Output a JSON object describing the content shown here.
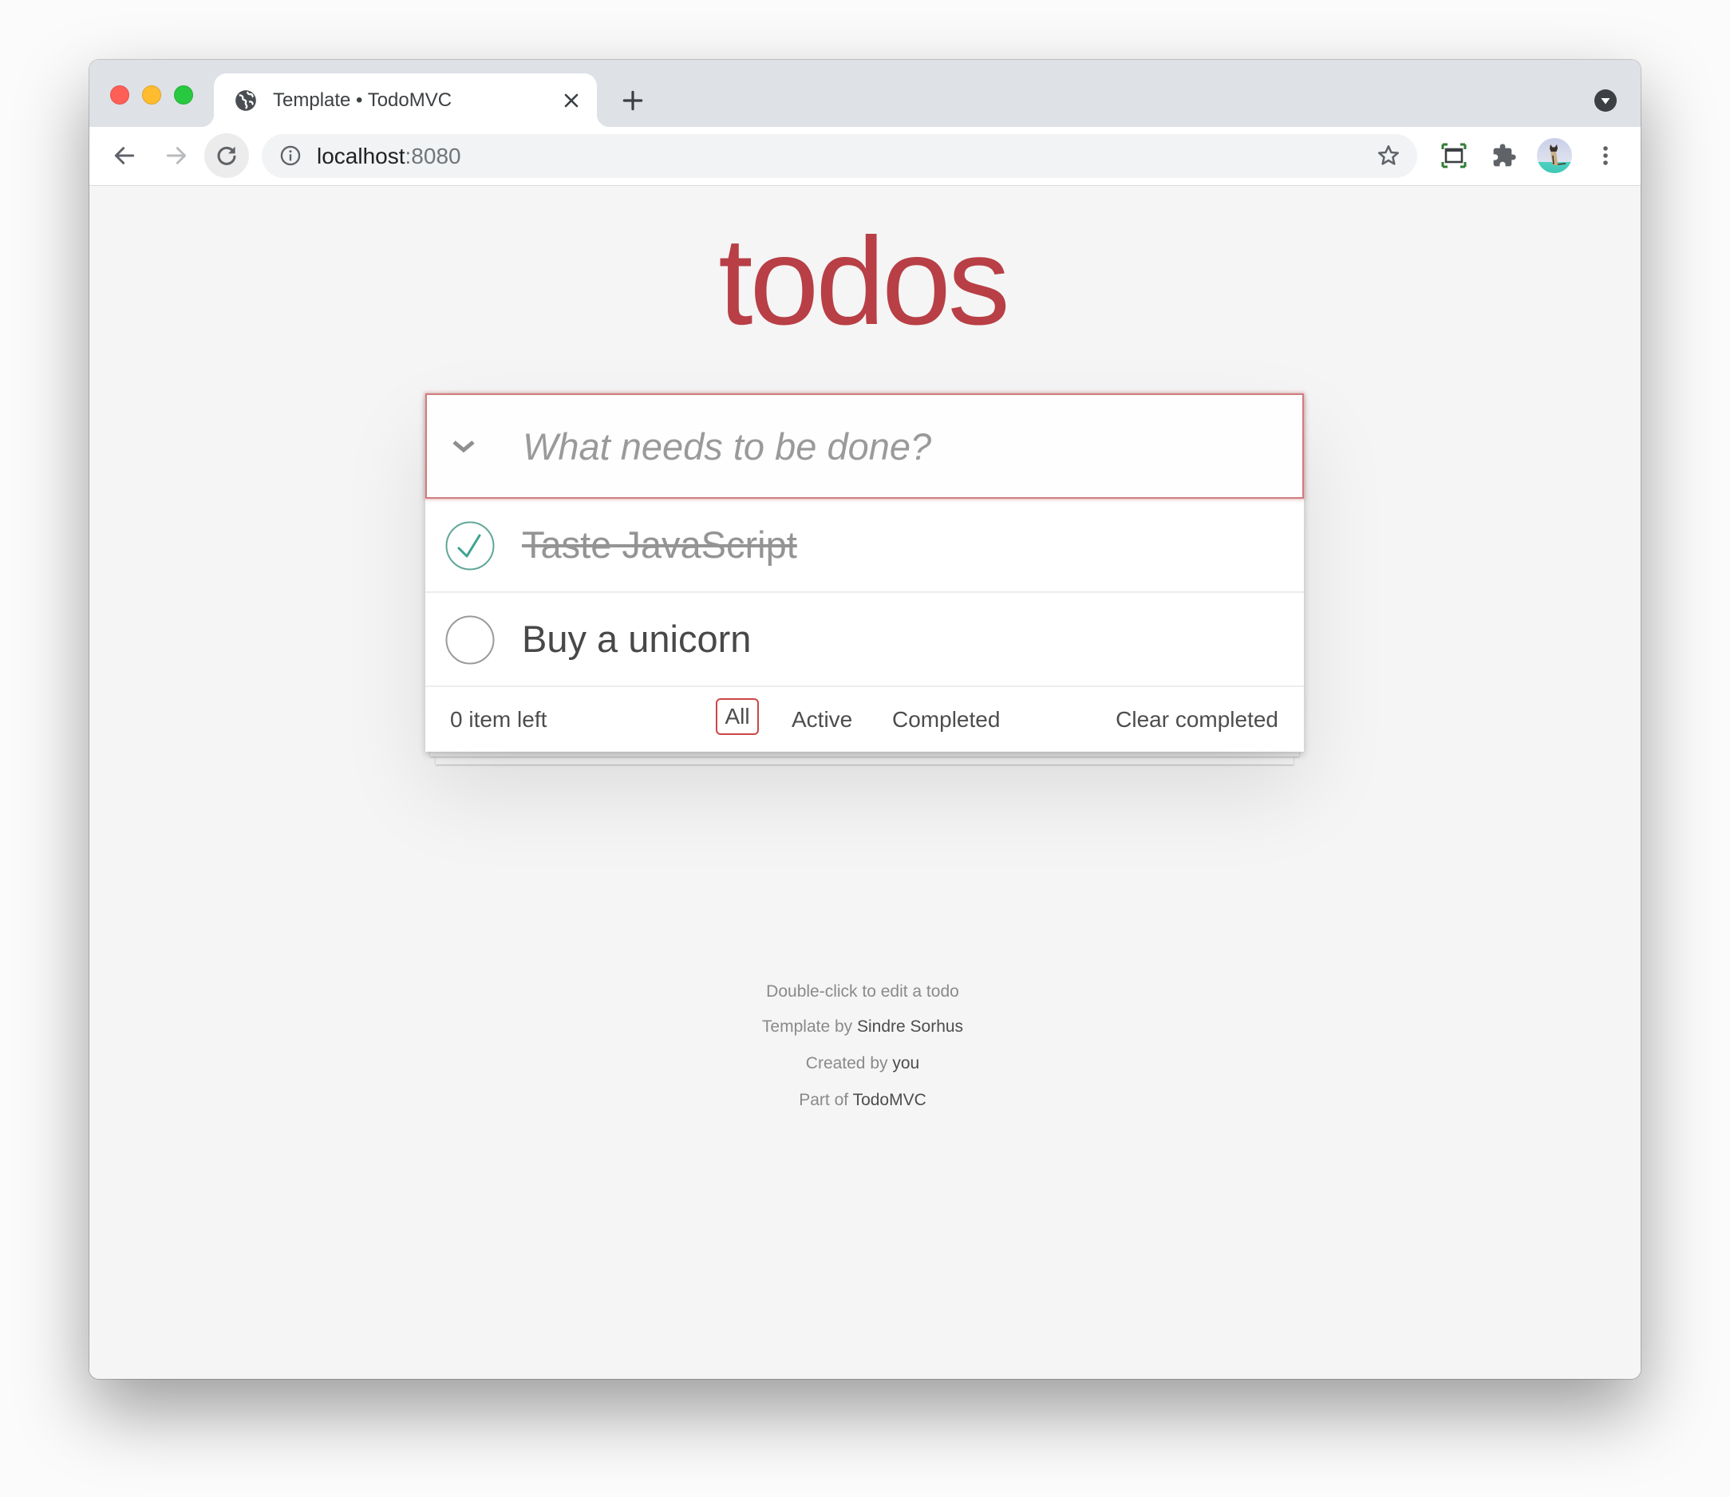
{
  "browser": {
    "tab": {
      "title": "Template • TodoMVC",
      "favicon": "globe-icon",
      "close_icon": "close-icon"
    },
    "new_tab_icon": "plus-icon",
    "tab_search_icon": "tab-search-dropdown-icon",
    "nav": {
      "back_icon": "arrow-left-icon",
      "forward_icon": "arrow-right-icon",
      "reload_icon": "reload-icon"
    },
    "address": {
      "site_info_icon": "info-icon",
      "host": "localhost",
      "port": ":8080",
      "bookmark_icon": "star-icon"
    },
    "toolbar_icons": [
      "screen-capture-icon",
      "extensions-puzzle-icon",
      "profile-avatar",
      "menu-kebab-icon"
    ],
    "colors": {
      "close": "#ff5f57",
      "minimize": "#febc2e",
      "maximize": "#28c840"
    }
  },
  "app": {
    "title": "todos",
    "accent_color": "#b83f45",
    "new_todo": {
      "placeholder": "What needs to be done?",
      "value": ""
    },
    "todos": [
      {
        "label": "Taste JavaScript",
        "completed": true
      },
      {
        "label": "Buy a unicorn",
        "completed": false
      }
    ],
    "footer": {
      "count_text": "0 item left",
      "filters": [
        {
          "label": "All",
          "selected": true
        },
        {
          "label": "Active",
          "selected": false
        },
        {
          "label": "Completed",
          "selected": false
        }
      ],
      "clear_completed": "Clear completed"
    },
    "info": {
      "hint": "Double-click to edit a todo",
      "template_prefix": "Template by ",
      "template_author": "Sindre Sorhus",
      "created_prefix": "Created by ",
      "created_author": "you",
      "part_prefix": "Part of ",
      "part_link": "TodoMVC"
    }
  }
}
